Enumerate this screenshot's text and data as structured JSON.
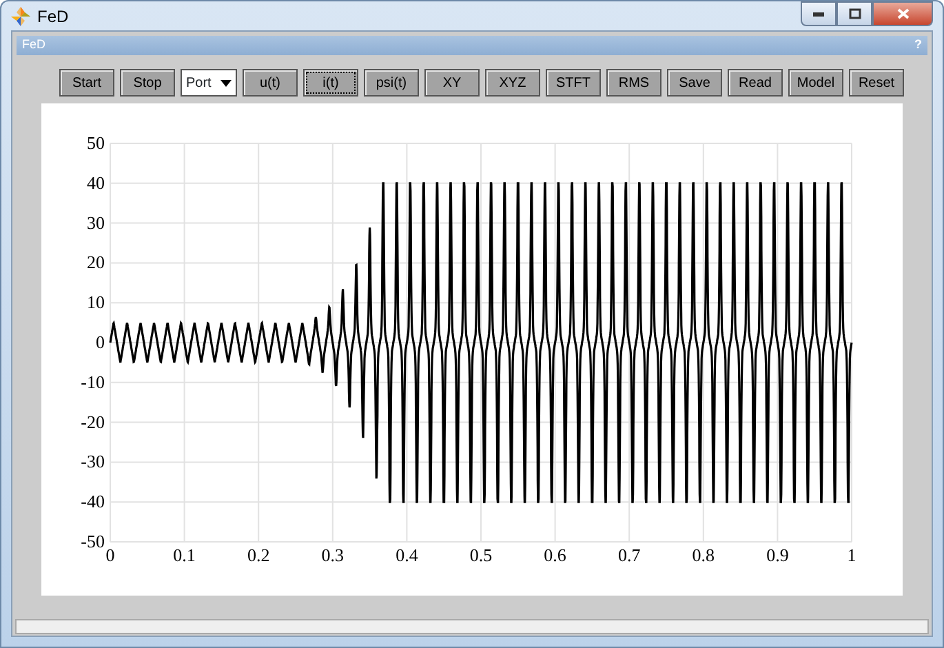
{
  "window": {
    "title": "FeD"
  },
  "panel": {
    "title": "FeD",
    "help": "?"
  },
  "toolbar": [
    {
      "kind": "button",
      "label": "Start",
      "focused": false
    },
    {
      "kind": "button",
      "label": "Stop",
      "focused": false
    },
    {
      "kind": "dropdown",
      "label": "Port",
      "focused": false
    },
    {
      "kind": "button",
      "label": "u(t)",
      "focused": false
    },
    {
      "kind": "button",
      "label": "i(t)",
      "focused": true
    },
    {
      "kind": "button",
      "label": "psi(t)",
      "focused": false
    },
    {
      "kind": "button",
      "label": "XY",
      "focused": false
    },
    {
      "kind": "button",
      "label": "XYZ",
      "focused": false
    },
    {
      "kind": "button",
      "label": "STFT",
      "focused": false
    },
    {
      "kind": "button",
      "label": "RMS",
      "focused": false
    },
    {
      "kind": "button",
      "label": "Save",
      "focused": false
    },
    {
      "kind": "button",
      "label": "Read",
      "focused": false
    },
    {
      "kind": "button",
      "label": "Model",
      "focused": false
    },
    {
      "kind": "button",
      "label": "Reset",
      "focused": false
    }
  ],
  "plot": {
    "y_ticks": [
      "50",
      "40",
      "30",
      "20",
      "10",
      "0",
      "-10",
      "-20",
      "-30",
      "-40",
      "-50"
    ],
    "x_ticks": [
      "0",
      "0.1",
      "0.2",
      "0.3",
      "0.4",
      "0.5",
      "0.6",
      "0.7",
      "0.8",
      "0.9",
      "1"
    ]
  }
}
